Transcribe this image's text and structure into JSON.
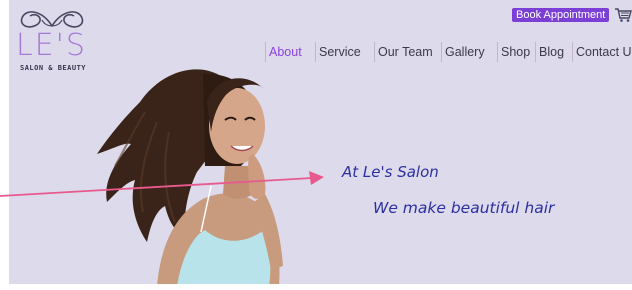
{
  "brand": {
    "name": "LE'S",
    "subtitle": "SALON & BEAUTY"
  },
  "header": {
    "book_button_label": "Book Appointment",
    "cart_icon": "cart-icon"
  },
  "nav": {
    "items": [
      {
        "label": "About",
        "active": true
      },
      {
        "label": "Service",
        "active": false
      },
      {
        "label": "Our Team",
        "active": false
      },
      {
        "label": "Gallery",
        "active": false
      },
      {
        "label": "Shop",
        "active": false
      },
      {
        "label": "Blog",
        "active": false
      },
      {
        "label": "Contact Us",
        "active": false
      }
    ]
  },
  "hero": {
    "line1": "At Le's Salon",
    "line2": "We make beautiful hair"
  },
  "colors": {
    "background": "#dcdaeb",
    "accent": "#8b44d9",
    "button": "#7b3fd6",
    "tagline": "#2c2fa0",
    "annotation_arrow": "#e85a8e"
  }
}
